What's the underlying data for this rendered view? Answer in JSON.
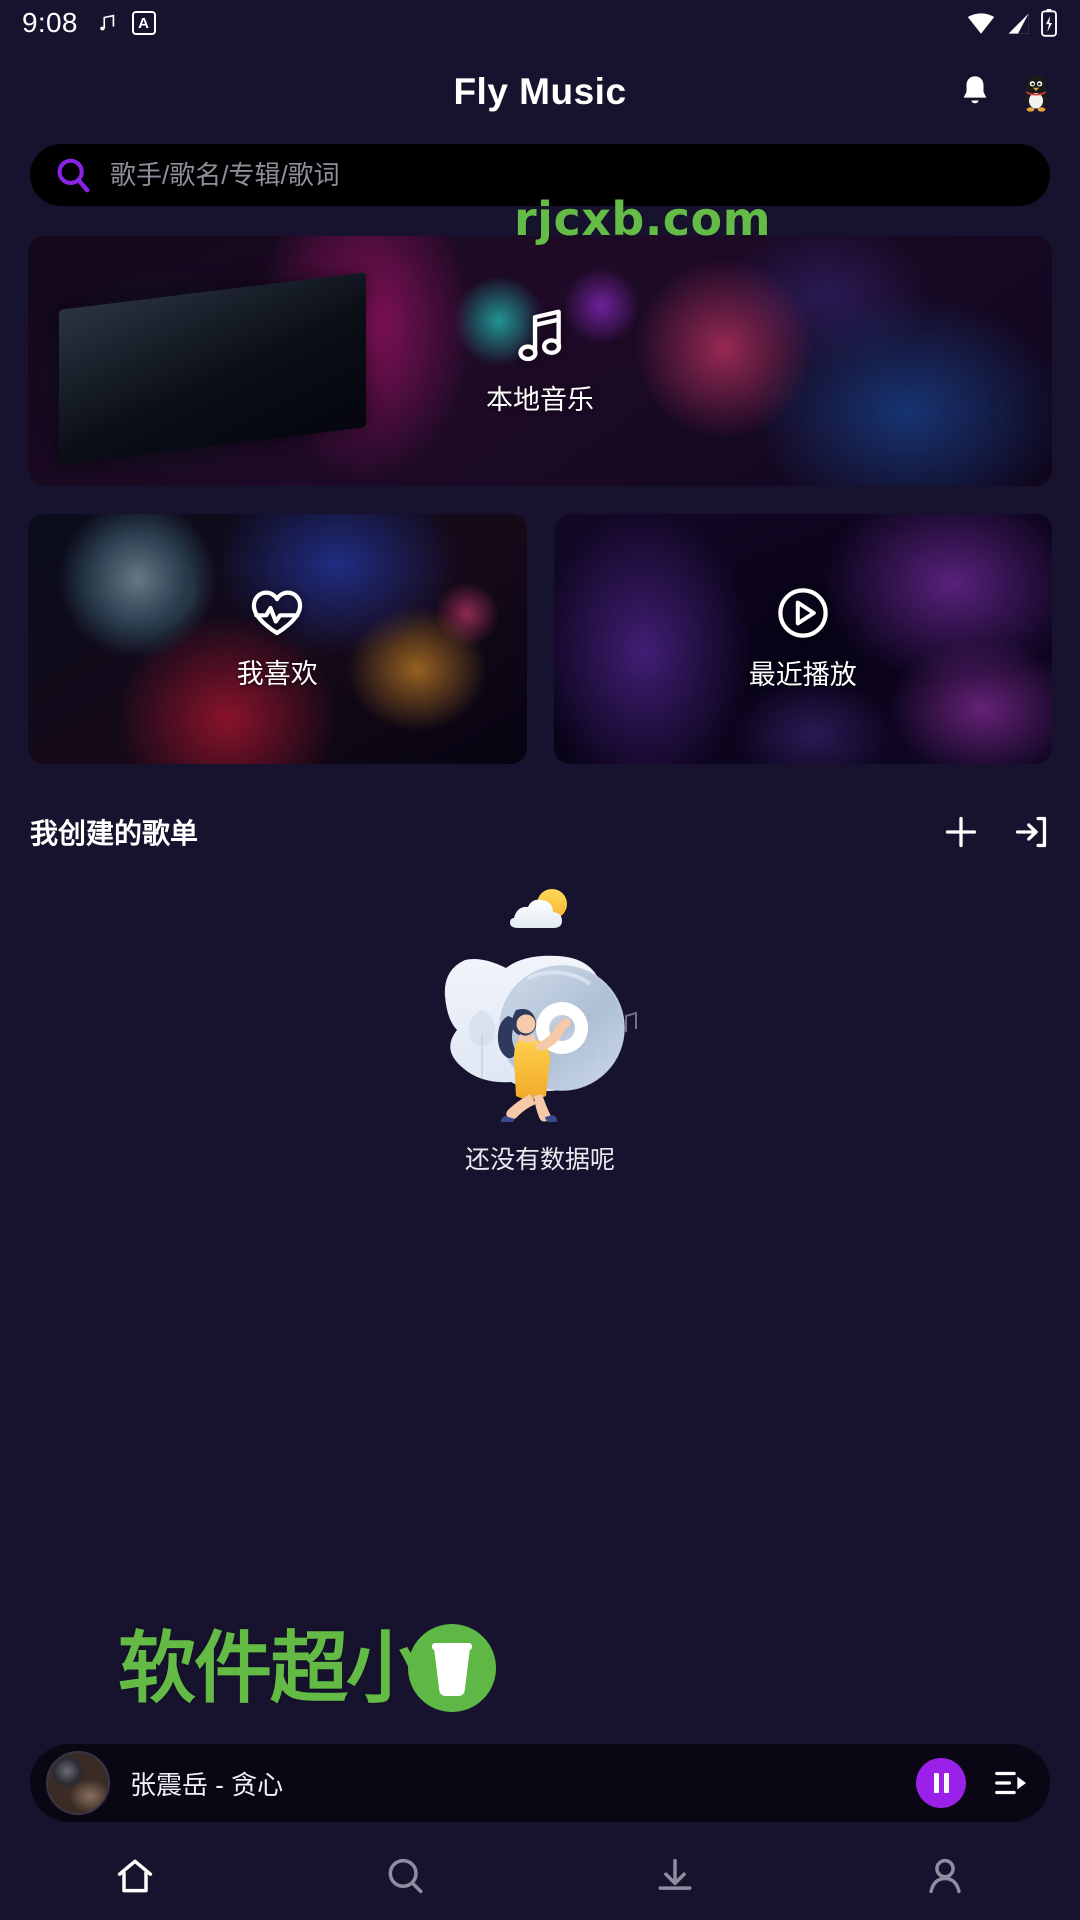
{
  "statusbar": {
    "time": "9:08",
    "icons": [
      "music-note-icon",
      "app-badge-a-icon",
      "wifi-icon",
      "cellular-signal-icon",
      "battery-icon"
    ],
    "badge_letter": "A"
  },
  "header": {
    "title": "Fly Music",
    "notification_icon": "bell-icon",
    "avatar_icon": "qq-penguin-avatar"
  },
  "search": {
    "placeholder": "歌手/歌名/专辑/歌词",
    "value": "",
    "icon": "search-icon"
  },
  "watermarks": {
    "top": "rjcxb.com",
    "bottom": "软件超小",
    "color": "#63bb45",
    "badge_icon": "cup-icon"
  },
  "cards": [
    {
      "label": "本地音乐",
      "icon": "music-notes-icon",
      "art": "dj-desk-photo"
    },
    {
      "label": "我喜欢",
      "icon": "heart-pulse-icon",
      "art": "vinyl-turntable-photo"
    },
    {
      "label": "最近播放",
      "icon": "play-circle-icon",
      "art": "purple-dj-photo"
    }
  ],
  "playlists": {
    "title": "我创建的歌单",
    "actions": [
      {
        "name": "add-playlist",
        "icon": "plus-icon"
      },
      {
        "name": "import-playlist",
        "icon": "import-arrow-icon"
      }
    ],
    "empty_text": "还没有数据呢",
    "empty_illustration": "girl-pushing-cd-illustration",
    "items": []
  },
  "player": {
    "now_playing": "张震岳 - 贪心",
    "artwork": "album-art-thumbnail",
    "state": "playing",
    "pause_icon": "pause-icon",
    "queue_icon": "playlist-queue-icon",
    "accent_color": "#9b21ea"
  },
  "bottom_nav": [
    {
      "name": "home",
      "icon": "home-icon",
      "active": true
    },
    {
      "name": "search",
      "icon": "search-icon",
      "active": false
    },
    {
      "name": "download",
      "icon": "download-icon",
      "active": false
    },
    {
      "name": "profile",
      "icon": "person-icon",
      "active": false
    }
  ],
  "theme": {
    "background": "#17132e",
    "surface": "#000000",
    "accent": "#9b21ea",
    "text": "#ffffff"
  }
}
